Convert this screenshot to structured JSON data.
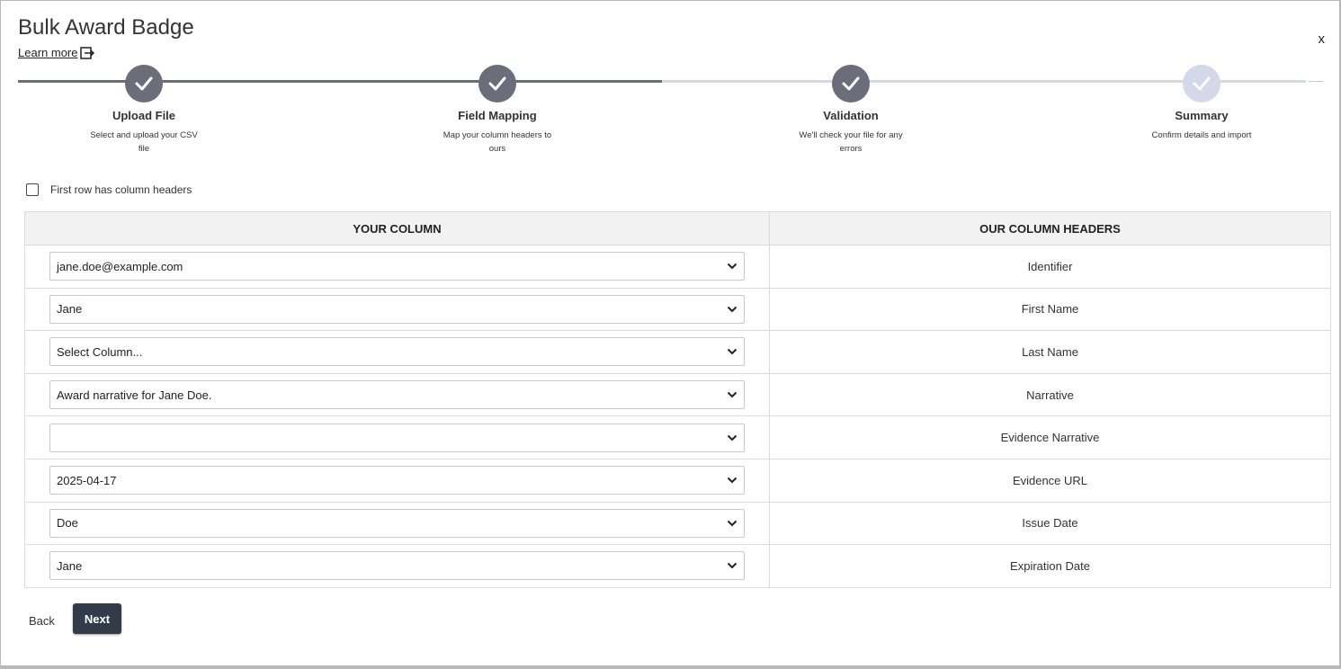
{
  "header": {
    "title": "Bulk Award Badge",
    "learn_more": "Learn more",
    "close": "x"
  },
  "stepper": {
    "steps": [
      {
        "name": "Upload File",
        "desc": "Select and upload your CSV file",
        "state": "complete"
      },
      {
        "name": "Field Mapping",
        "desc": "Map your column headers to ours",
        "state": "complete"
      },
      {
        "name": "Validation",
        "desc": "We'll check your file for any errors",
        "state": "complete"
      },
      {
        "name": "Summary",
        "desc": "Confirm details and import",
        "state": "pending"
      }
    ],
    "colors": {
      "complete": "#6b6e7a",
      "pending": "#d5d8e8"
    }
  },
  "options": {
    "first_row_headers_label": "First row has column headers",
    "first_row_headers_checked": false
  },
  "table": {
    "headers": {
      "yours": "YOUR COLUMN",
      "ours": "OUR COLUMN HEADERS"
    },
    "rows": [
      {
        "selected": "jane.doe@example.com",
        "ours": "Identifier"
      },
      {
        "selected": "Jane",
        "ours": "First Name"
      },
      {
        "selected": "Select Column...",
        "ours": "Last Name"
      },
      {
        "selected": "Award narrative for Jane Doe.",
        "ours": "Narrative"
      },
      {
        "selected": "",
        "ours": "Evidence Narrative"
      },
      {
        "selected": "2025-04-17",
        "ours": "Evidence URL"
      },
      {
        "selected": "Doe",
        "ours": "Issue Date"
      },
      {
        "selected": "Jane",
        "ours": "Expiration Date"
      }
    ]
  },
  "footer": {
    "back": "Back",
    "next": "Next"
  },
  "icons": {
    "step_check": "check-icon",
    "learn_more": "external-link-icon",
    "select": "chevron-down-icon"
  }
}
